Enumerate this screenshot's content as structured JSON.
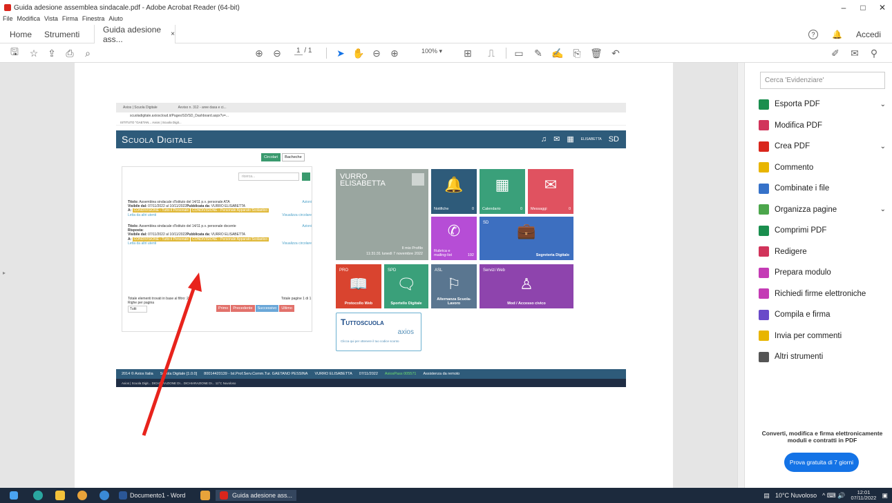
{
  "window": {
    "title": "Guida adesione assemblea sindacale.pdf - Adobe Acrobat Reader (64-bit)",
    "controls": [
      "–",
      "□",
      "✕"
    ]
  },
  "menu": [
    "File",
    "Modifica",
    "Vista",
    "Firma",
    "Finestra",
    "Aiuto"
  ],
  "tabs": {
    "home": "Home",
    "tools": "Strumenti",
    "doc": "Guida adesione ass...",
    "close": "×",
    "signin": "Accedi"
  },
  "toolbar": {
    "page_current": "1",
    "page_total": "/ 1",
    "zoom": "100%"
  },
  "embedded": {
    "chrome_tab1": "Axios | Scuola Digitale",
    "chrome_tab2": "Avviso n. 312 - aree dasa e ci...",
    "url": "scuoladigitale.axioscloud.it/Pages/SD/SD_Dashboard.aspx?v=...",
    "bookmarks": "ISTITUTO \"GAETAN...   Axios | Scuola Digit...",
    "brand": "Scuola Digitale",
    "user": "ELISABETTA",
    "sd_logo": "SD",
    "btn_circolari": "Circolari",
    "btn_bacheche": "Bacheche",
    "search_placeholder": "ricerca...",
    "circolare1": {
      "titolo_label": "Titolo:",
      "titolo": "Assemblea sindacale d'Istituto del 14/11 p.v. personale ATA",
      "azioni": "Azioni",
      "visibile_label": "Visibile dal:",
      "visibile": "07/11/2022 al 10/11/2022",
      "pubblicata_label": "Pubblicata da:",
      "pubblicata": "VURRO ELISABETTA",
      "a_label": "A:",
      "tag1": "CONDIVISIONE - Tutto il Personale",
      "tag2": "CONDIVISIONE - Personale Apparato Scolastico",
      "letta": "Letta da altri",
      "utenti": "utenti",
      "visualizza": "Visualizza circolare"
    },
    "circolare2": {
      "titolo_label": "Titolo:",
      "titolo": "Assemblea sindacale d'Istituto del 14/11 p.v. personale docente",
      "azioni": "Azioni",
      "risposta": "Risposta:",
      "visibile_label": "Visibile dal:",
      "visibile": "07/11/2022 al 10/11/2022",
      "pubblicata_label": "Pubblicata da:",
      "pubblicata": "VURRO ELISABETTA",
      "a_label": "A:",
      "tag1": "CONDIVISIONE - Tutto il Personale",
      "tag2": "CONDIVISIONE - Personale Apparato Scolastico",
      "letta": "Letta da altri",
      "utenti": "utenti",
      "visualizza": "Visualizza circolare"
    },
    "totale": "Totale elementi trovati in base al filtro: 2",
    "righe": "Righe per pagina",
    "tutti": "Tutti",
    "totale_pagine": "Totale pagine 1 di 1",
    "pager": [
      "Primo",
      "Precedente",
      "Successivo",
      "Ultimo"
    ],
    "tiles": {
      "profile_name": "VURRO ELISABETTA",
      "profile_label": "Il mio Profilo",
      "profile_date": "11:31:31 lunedì 7 novembre 2022",
      "notifiche": "Notifiche",
      "notifiche_n": "0",
      "calendario": "Calendario",
      "calendario_n": "0",
      "messaggi": "Messaggi",
      "messaggi_n": "0",
      "rubrica": "Rubrica e mailing-list",
      "rubrica_n": "192",
      "sd_corner": "SD",
      "segreteria": "Segreteria Digitale",
      "pro": "PRO",
      "protocollo": "Protocollo Web",
      "spd": "SPD",
      "sportello": "Sportello Digitale",
      "asl": "ASL",
      "alternanza": "Alternanza Scuola-Lavoro",
      "servizi": "Servizi Web",
      "mod": "Mod / Accesso civico"
    },
    "tuttoscuola": "Tuttoscuola",
    "axios": "axios",
    "tutto_sub": "Clicca qui per ottenere il tuo codice sconto",
    "footer": {
      "copy": "2014 © Axios Italia",
      "ver": "Scuola Digitale [1.0.0]",
      "istituto": "80014420139 - Ist.Prof.Serv.Comm.Tur. GAETANO PESSINA",
      "user": "VURRO ELISABETTA",
      "date": "07/11/2022",
      "axiospass": "AxiosPass 005571",
      "assist": "Assistenza da remoto"
    },
    "taskbar": "Axios | Scuola Digit...   DICHIARAZIONE DI...   DICHIARAZIONE DI...   11°C Nuvoloso"
  },
  "rpanel": {
    "search_placeholder": "Cerca 'Evidenziare'",
    "tools": [
      {
        "label": "Esporta PDF",
        "chev": "⌄",
        "color": "#1a8e4e"
      },
      {
        "label": "Modifica PDF",
        "chev": "",
        "color": "#d1345b"
      },
      {
        "label": "Crea PDF",
        "chev": "⌄",
        "color": "#d9261c"
      },
      {
        "label": "Commento",
        "chev": "",
        "color": "#e8b500"
      },
      {
        "label": "Combinate i file",
        "chev": "",
        "color": "#3672c9"
      },
      {
        "label": "Organizza pagine",
        "chev": "⌄",
        "color": "#4ca64c"
      },
      {
        "label": "Comprimi PDF",
        "chev": "",
        "color": "#1a8e4e"
      },
      {
        "label": "Redigere",
        "chev": "",
        "color": "#d1345b"
      },
      {
        "label": "Prepara modulo",
        "chev": "",
        "color": "#c43bb5"
      },
      {
        "label": "Richiedi firme elettroniche",
        "chev": "",
        "color": "#c43bb5"
      },
      {
        "label": "Compila e firma",
        "chev": "",
        "color": "#6a4bc9"
      },
      {
        "label": "Invia per commenti",
        "chev": "",
        "color": "#e8b500"
      },
      {
        "label": "Altri strumenti",
        "chev": "",
        "color": "#555555"
      }
    ],
    "promo": "Converti, modifica e firma elettronicamente moduli e contratti in PDF",
    "trial": "Prova gratuita di 7 giorni"
  },
  "taskbar": {
    "word": "Documento1 - Word",
    "acrobat": "Guida adesione ass...",
    "weather": "10°C Nuvoloso",
    "time": "12:01",
    "date": "07/11/2022"
  }
}
